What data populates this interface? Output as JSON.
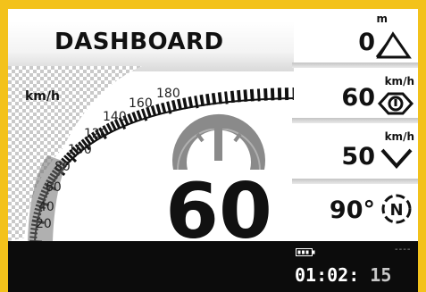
{
  "header": {
    "title": "DASHBOARD"
  },
  "speedometer": {
    "unit": "km/h",
    "speed": "60",
    "scale_labels": [
      "20",
      "40",
      "60",
      "80",
      "100",
      "120",
      "140",
      "160",
      "180"
    ],
    "needle_icon": "speedometer-icon"
  },
  "right_panel": {
    "altitude": {
      "value": "0",
      "unit": "m",
      "icon": "mountain-icon"
    },
    "speed_limit": {
      "value": "60",
      "unit": "km/h",
      "icon": "speed-sensor-icon"
    },
    "min_speed": {
      "value": "50",
      "unit": "km/h",
      "icon": "chevron-down-icon"
    },
    "heading": {
      "value": "90°",
      "icon": "compass-n-icon"
    }
  },
  "status_bar": {
    "battery_icon": "battery-icon",
    "placeholder": "----",
    "time_hm": "01:02:",
    "time_s": "15"
  },
  "colors": {
    "frame": "#f3c21b",
    "status_bar": "#0c0c0c",
    "gauge_gray": "#8a8a8a"
  }
}
